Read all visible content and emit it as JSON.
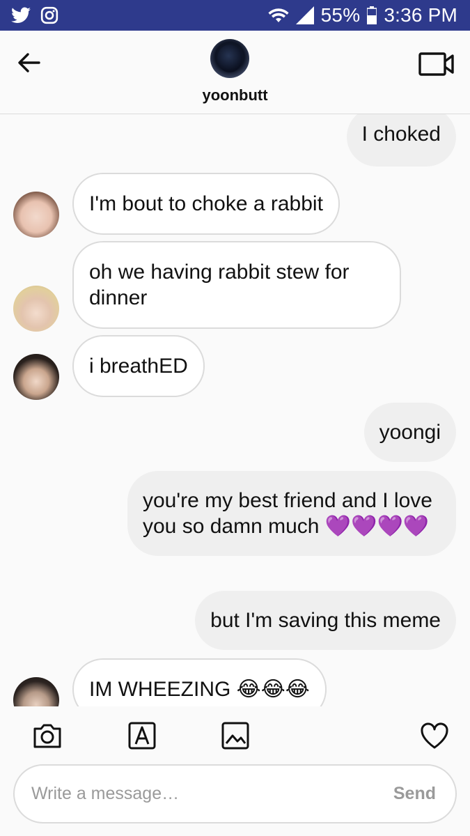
{
  "status_bar": {
    "battery": "55%",
    "time": "3:36 PM",
    "icons": [
      "twitter-icon",
      "instagram-icon",
      "wifi-icon",
      "signal-icon",
      "battery-icon"
    ],
    "background": "#2e3a8c"
  },
  "header": {
    "username": "yoonbutt",
    "icons": [
      "back-arrow-icon",
      "video-call-icon"
    ]
  },
  "messages": [
    {
      "direction": "out",
      "text": "I choked"
    },
    {
      "direction": "in",
      "text": "I'm bout to choke a rabbit"
    },
    {
      "direction": "in",
      "text": "oh we having rabbit stew for dinner"
    },
    {
      "direction": "in",
      "text": "i breathED"
    },
    {
      "direction": "out",
      "text": "yoongi"
    },
    {
      "direction": "out",
      "text": "you're my best friend and I love you so damn much 💜💜💜💜"
    },
    {
      "direction": "out",
      "text": "but I'm saving this meme"
    },
    {
      "direction": "in",
      "text": "IM WHEEZING 😂😂😂"
    }
  ],
  "toolbar": {
    "icons": [
      "camera-icon",
      "text-sticker-icon",
      "gallery-icon",
      "heart-icon"
    ]
  },
  "composer": {
    "placeholder": "Write a message…",
    "send_label": "Send"
  },
  "colors": {
    "outgoing_bubble": "#efefef",
    "incoming_border": "#dbdbdb",
    "heart_emoji": "#a020f0"
  }
}
